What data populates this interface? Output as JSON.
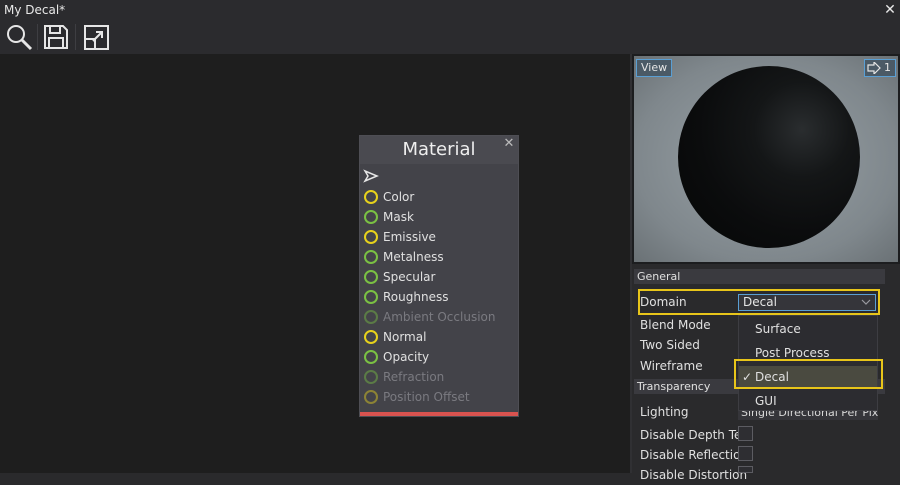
{
  "window": {
    "title": "My Decal*",
    "close_glyph": "✕"
  },
  "toolbar": {
    "buttons": [
      "search-icon",
      "save-icon",
      "show-in-explorer-icon"
    ]
  },
  "node": {
    "title": "Material",
    "close_glyph": "✕",
    "ports": [
      {
        "label": "Color",
        "connected": true,
        "enabled": true
      },
      {
        "label": "Mask",
        "connected": false,
        "enabled": true
      },
      {
        "label": "Emissive",
        "connected": true,
        "enabled": true
      },
      {
        "label": "Metalness",
        "connected": false,
        "enabled": true
      },
      {
        "label": "Specular",
        "connected": false,
        "enabled": true
      },
      {
        "label": "Roughness",
        "connected": false,
        "enabled": true
      },
      {
        "label": "Ambient Occlusion",
        "connected": false,
        "enabled": false
      },
      {
        "label": "Normal",
        "connected": true,
        "enabled": true
      },
      {
        "label": "Opacity",
        "connected": false,
        "enabled": true
      },
      {
        "label": "Refraction",
        "connected": false,
        "enabled": false
      },
      {
        "label": "Position Offset",
        "connected": true,
        "enabled": false
      }
    ],
    "colors": {
      "connected_port": "#e6d21c",
      "unconnected_port": "#7bc043",
      "accent_bar": "#d9534f"
    }
  },
  "preview": {
    "view_label": "View",
    "count": "1"
  },
  "properties": {
    "general_header": "General",
    "domain_label": "Domain",
    "domain_value": "Decal",
    "blend_mode_label": "Blend Mode",
    "two_sided_label": "Two Sided",
    "wireframe_label": "Wireframe",
    "transparency_header": "Transparency",
    "lighting_label": "Lighting",
    "lighting_value": "Single Directional Per Pixel",
    "disable_depth_test_label": "Disable Depth Tes",
    "disable_reflection_label": "Disable Reflection",
    "disable_distortion_label": "Disable Distortion"
  },
  "dropdown": {
    "options": [
      "Surface",
      "Post Process",
      "Decal",
      "GUI"
    ],
    "selected": "Decal",
    "check_glyph": "✓"
  },
  "highlight_color": "#e8c51a"
}
